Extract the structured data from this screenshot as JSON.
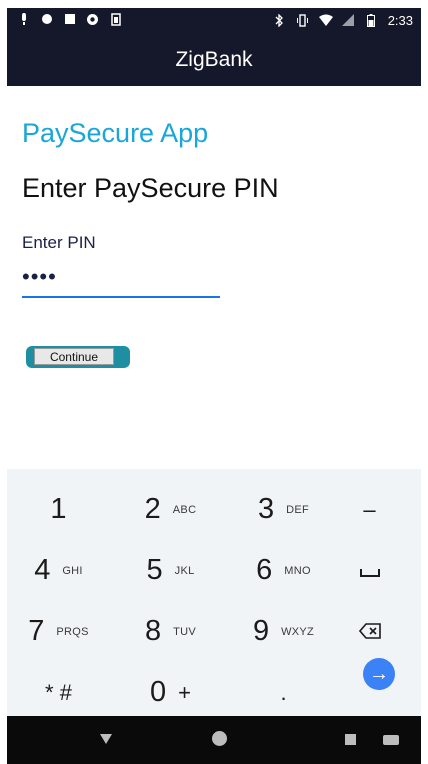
{
  "status_bar": {
    "time": "2:33",
    "left_icons": [
      "mic-icon",
      "circle-icon",
      "image-icon",
      "settings-icon",
      "battery-saver-icon"
    ],
    "right_icons": [
      "bluetooth-icon",
      "vibrate-icon",
      "wifi-icon",
      "signal-icon",
      "battery-icon"
    ]
  },
  "app_bar": {
    "title": "ZigBank"
  },
  "content": {
    "app_title": "PaySecure App",
    "heading": "Enter PaySecure PIN",
    "pin_label": "Enter PIN",
    "pin_value": "••••",
    "continue_label": "Continue"
  },
  "keypad": {
    "rows": [
      [
        {
          "num": "1",
          "sub": ""
        },
        {
          "num": "2",
          "sub": "ABC"
        },
        {
          "num": "3",
          "sub": "DEF"
        },
        {
          "sym": "–"
        }
      ],
      [
        {
          "num": "4",
          "sub": "GHI"
        },
        {
          "num": "5",
          "sub": "JKL"
        },
        {
          "num": "6",
          "sub": "MNO"
        },
        {
          "sym": "␣"
        }
      ],
      [
        {
          "num": "7",
          "sub": "PRQS"
        },
        {
          "num": "8",
          "sub": "TUV"
        },
        {
          "num": "9",
          "sub": "WXYZ"
        },
        {
          "sym": "⌫"
        }
      ],
      [
        {
          "num": "* #",
          "sub": ""
        },
        {
          "num": "0",
          "sub": "+"
        },
        {
          "num": ".",
          "sub": ""
        },
        {
          "sym": "→"
        }
      ]
    ]
  },
  "nav_bar": {
    "back_icon": "back-icon",
    "home_icon": "home-icon",
    "recent_icon": "recent-apps-icon",
    "keyboard_icon": "keyboard-icon"
  },
  "colors": {
    "accent": "#1aa6d8",
    "bar": "#15182b",
    "keypad_bg": "#f1f4f6",
    "enter": "#3b82f6"
  }
}
